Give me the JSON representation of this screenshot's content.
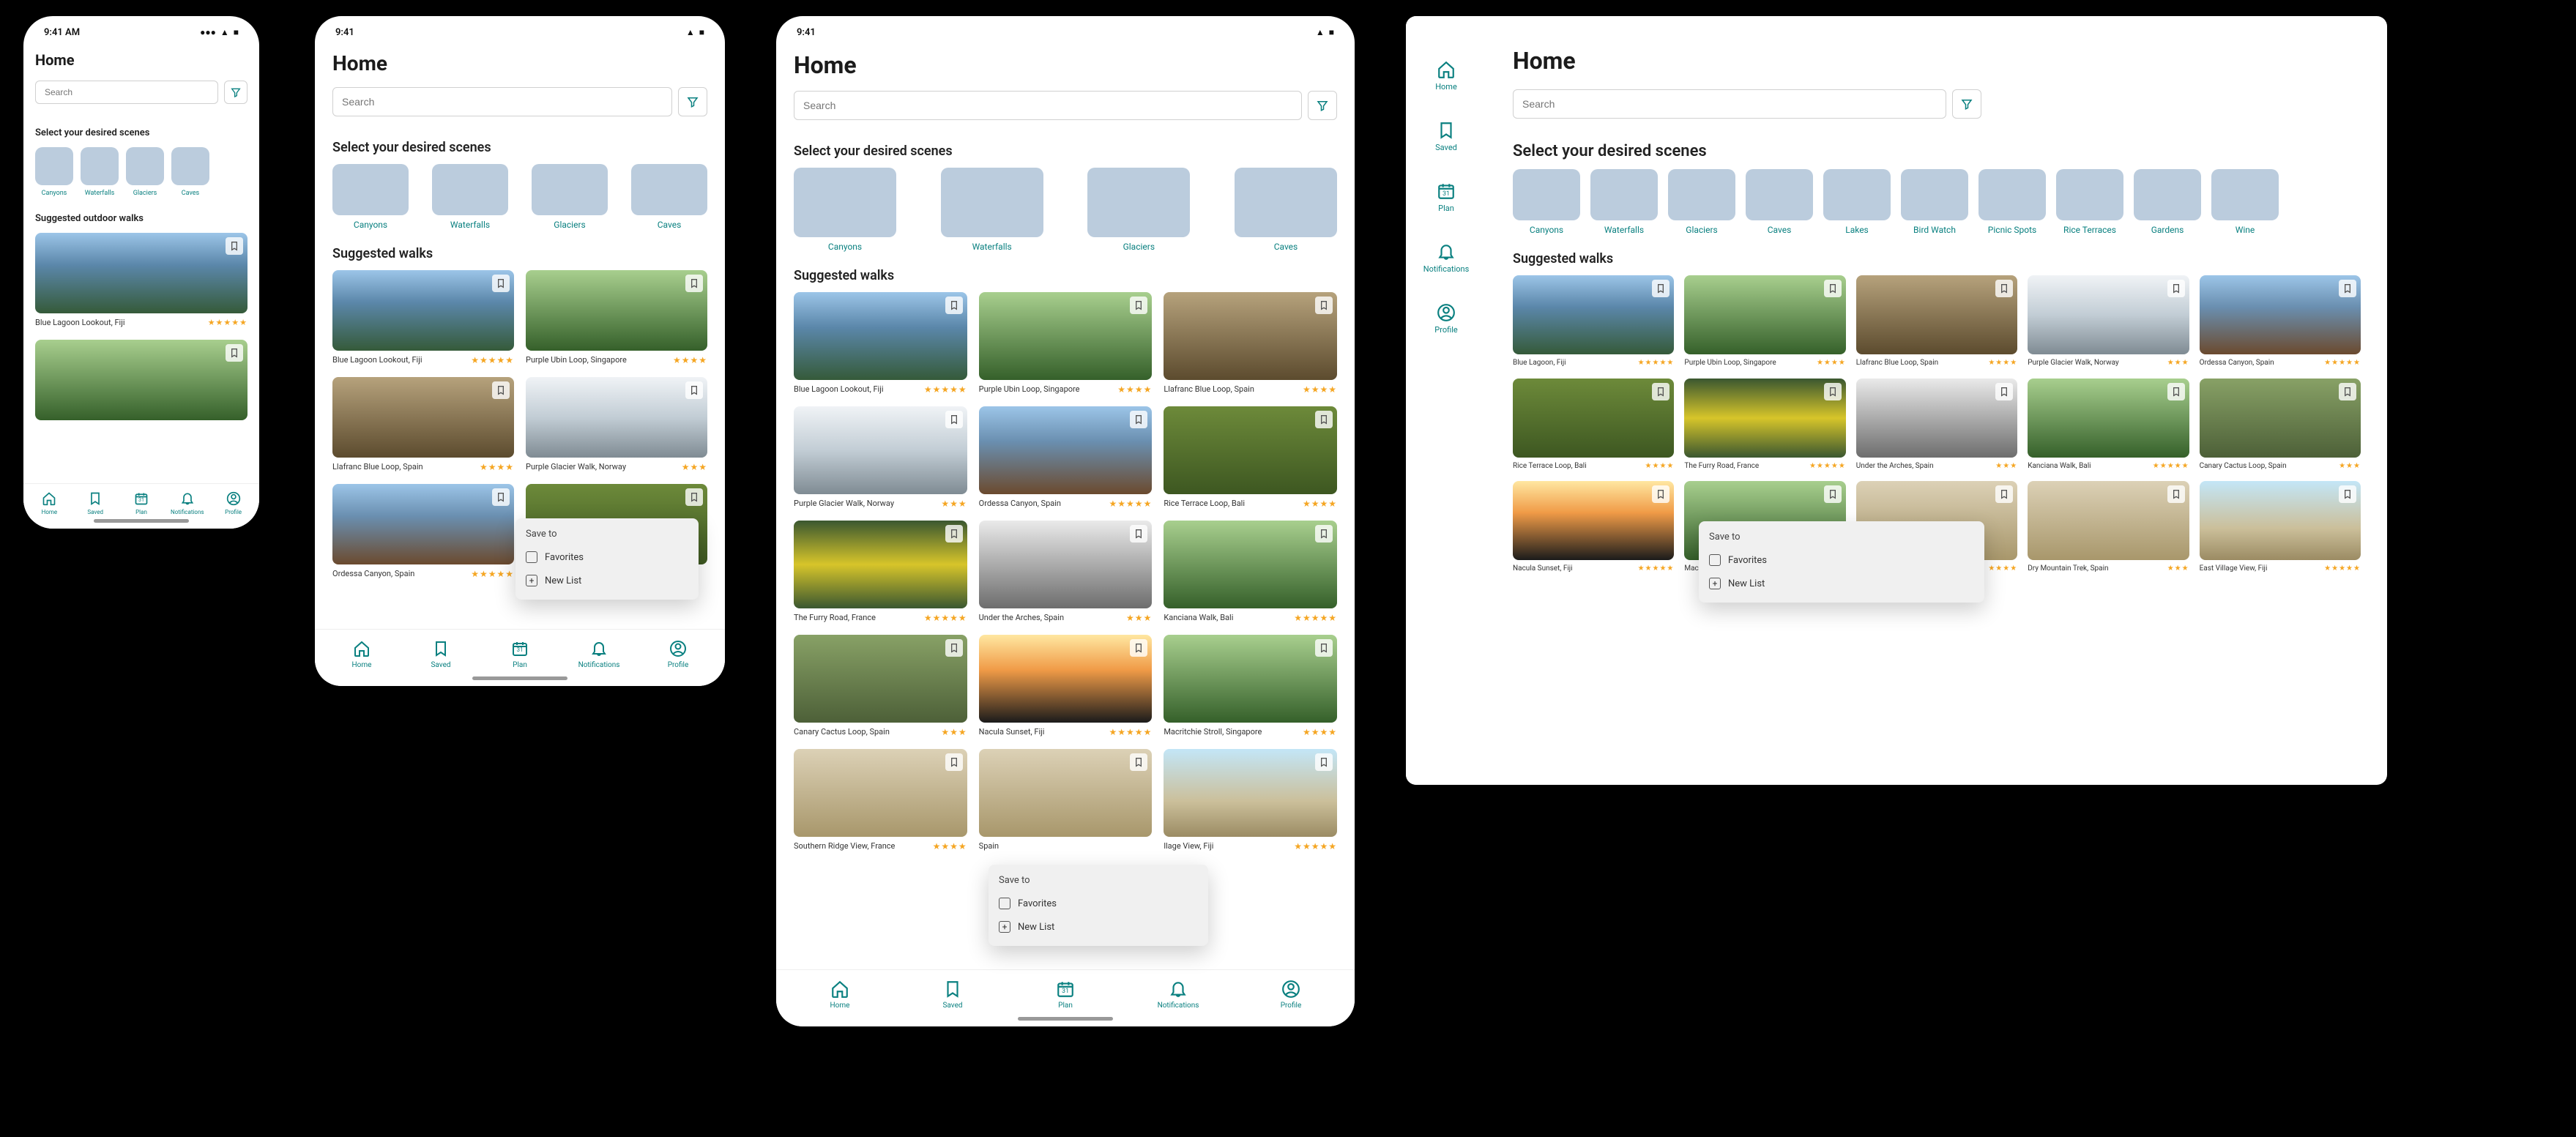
{
  "status": {
    "time": "9:41",
    "time_alt": "9:41 AM"
  },
  "home": {
    "title": "Home"
  },
  "search": {
    "placeholder": "Search"
  },
  "section": {
    "scenes": "Select your desired scenes",
    "suggested": "Suggested walks",
    "suggested_phone": "Suggested outdoor walks"
  },
  "scenes": [
    {
      "key": "canyons",
      "label": "Canyons",
      "ph": "ph-canyon"
    },
    {
      "key": "waterfalls",
      "label": "Waterfalls",
      "ph": "ph-waterfall"
    },
    {
      "key": "glaciers",
      "label": "Glaciers",
      "ph": "ph-glacier"
    },
    {
      "key": "caves",
      "label": "Caves",
      "ph": "ph-cave"
    },
    {
      "key": "lakes",
      "label": "Lakes",
      "ph": "ph-lake"
    },
    {
      "key": "birdwatch",
      "label": "Bird Watch",
      "ph": "ph-bird"
    },
    {
      "key": "picnic",
      "label": "Picnic Spots",
      "ph": "ph-picnic"
    },
    {
      "key": "rice",
      "label": "Rice Terraces",
      "ph": "ph-rice"
    },
    {
      "key": "gardens",
      "label": "Gardens",
      "ph": "ph-garden"
    },
    {
      "key": "wine",
      "label": "Wine",
      "ph": "ph-wine"
    }
  ],
  "walks": {
    "blue": {
      "title": "Blue Lagoon Lookout, Fiji",
      "title_short": "Blue Lagoon, Fiji",
      "rating": 5,
      "ph": "ph-blue"
    },
    "ubin": {
      "title": "Purple Ubin Loop, Singapore",
      "rating": 4,
      "ph": "ph-green"
    },
    "llafranc": {
      "title": "Llafranc Blue Loop, Spain",
      "rating": 4,
      "ph": "ph-rocks"
    },
    "glacier": {
      "title": "Purple Glacier Walk, Norway",
      "rating": 3,
      "ph": "ph-glacier"
    },
    "ordessa": {
      "title": "Ordessa Canyon, Spain",
      "rating": 5,
      "ph": "ph-canyon"
    },
    "ricebali": {
      "title": "Rice Terrace Loop, Bali",
      "rating": 4,
      "ph": "ph-rice"
    },
    "furry": {
      "title": "The Furry Road, France",
      "rating": 5,
      "ph": "ph-bird"
    },
    "arches": {
      "title": "Under the Arches, Spain",
      "rating": 3,
      "ph": "ph-bw"
    },
    "kanciana": {
      "title": "Kanciana Walk, Bali",
      "rating": 5,
      "ph": "ph-green"
    },
    "cactus": {
      "title": "Canary Cactus Loop, Spain",
      "rating": 3,
      "ph": "ph-wine"
    },
    "nacula": {
      "title": "Nacula Sunset, Fiji",
      "rating": 5,
      "ph": "ph-sunset"
    },
    "macritchie": {
      "title": "Macritchie Stroll, Singapore",
      "rating": 4,
      "ph": "ph-green"
    },
    "southern": {
      "title": "Southern Ridge View, France",
      "rating": 4,
      "ph": "ph-desert"
    },
    "dry": {
      "title": "Dry Mountain Trek, Spain",
      "rating": 3,
      "ph": "ph-desert"
    },
    "village": {
      "title": "East Village View, Fiji",
      "title_trunc": "llage View, Fiji",
      "rating": 5,
      "ph": "ph-coast"
    }
  },
  "tabs": {
    "home": "Home",
    "saved": "Saved",
    "plan": "Plan",
    "plan_date": "31",
    "notifications": "Notifications",
    "profile": "Profile"
  },
  "popover": {
    "head": "Save to",
    "favorites": "Favorites",
    "newlist": "New List"
  }
}
